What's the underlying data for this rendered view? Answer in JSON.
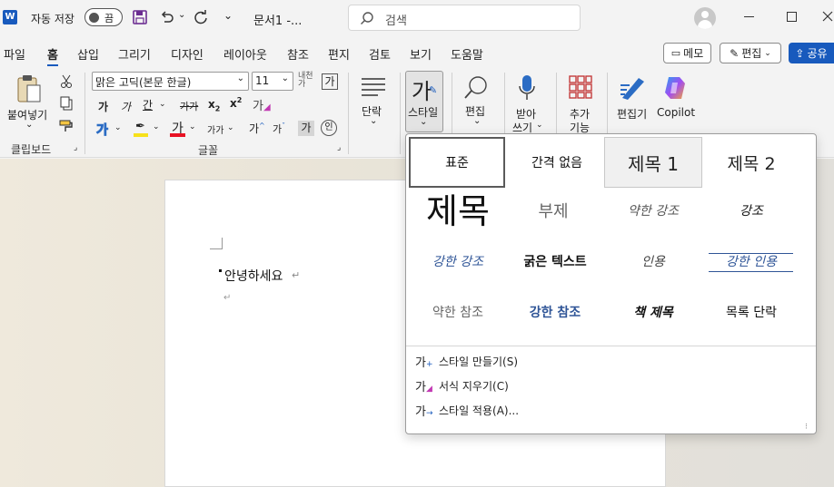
{
  "titlebar": {
    "autosave_label": "자동 저장",
    "toggle_state": "끔",
    "doc_title": "문서1 -...",
    "search_placeholder": "검색"
  },
  "tabs": [
    "파일",
    "홈",
    "삽입",
    "그리기",
    "디자인",
    "레이아웃",
    "참조",
    "편지",
    "검토",
    "보기",
    "도움말"
  ],
  "tabs_active": "홈",
  "header_buttons": {
    "memo": "메모",
    "edit": "편집",
    "share": "공유"
  },
  "ribbon": {
    "clipboard": {
      "paste": "붙여넣기",
      "group": "클립보드"
    },
    "font": {
      "name": "맑은 고딕(본문 한글)",
      "size": "11",
      "group": "글꼴",
      "big_char": "가"
    },
    "paragraph": {
      "label": "단락"
    },
    "styles": {
      "label": "스타일",
      "char": "가"
    },
    "editing": {
      "label": "편집"
    },
    "dictate": {
      "label1": "받아",
      "label2": "쓰기"
    },
    "addins": {
      "label1": "추가",
      "label2": "기능"
    },
    "editor": {
      "label": "편집기"
    },
    "copilot": {
      "label": "Copilot"
    }
  },
  "document": {
    "text": "안녕하세요",
    "para_mark": "↵"
  },
  "styles_gallery": {
    "rows": [
      [
        "표준",
        "간격 없음",
        "제목 1",
        "제목 2"
      ],
      [
        "제목",
        "부제",
        "약한 강조",
        "강조"
      ],
      [
        "강한 강조",
        "굵은 텍스트",
        "인용",
        "강한 인용"
      ],
      [
        "약한 참조",
        "강한 참조",
        "책 제목",
        "목록 단락"
      ]
    ],
    "menu": [
      {
        "label": "스타일 만들기(S)",
        "icon": "create-style-icon"
      },
      {
        "label": "서식 지우기(C)",
        "icon": "clear-format-icon"
      },
      {
        "label": "스타일 적용(A)...",
        "icon": "apply-style-icon"
      }
    ]
  },
  "colors": {
    "accent": "#185abd",
    "highlight": "#f7e11a",
    "fontcolor": "#e81123",
    "intense": "#2f5597"
  }
}
